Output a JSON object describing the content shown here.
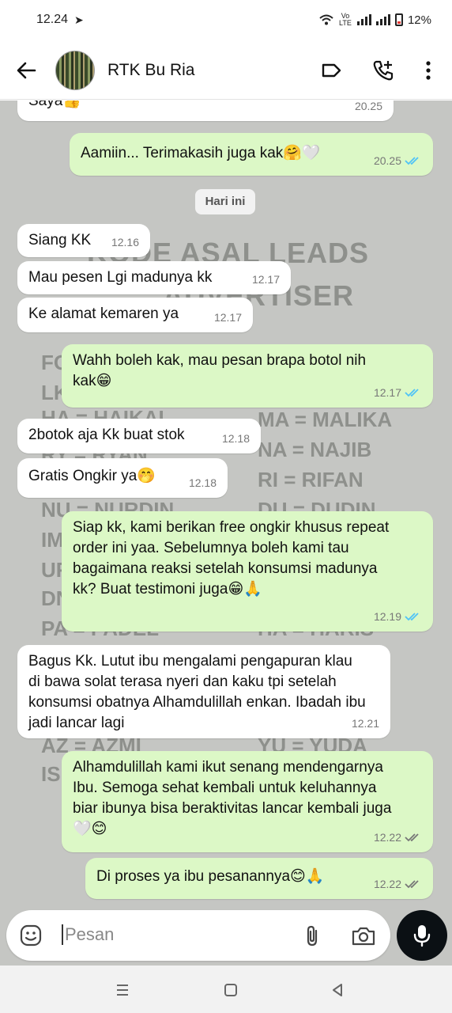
{
  "status": {
    "time": "12.24",
    "volte": "Vo LTE",
    "battery": "12%"
  },
  "header": {
    "contact_name": "RTK Bu Ria"
  },
  "date_separator": "Hari ini",
  "messages": [
    {
      "dir": "in",
      "text": "Saya👍",
      "time": "20.25"
    },
    {
      "dir": "out",
      "text": "Aamiin... Terimakasih juga kak🤗🤍",
      "time": "20.25",
      "status": "read"
    },
    {
      "dir": "in",
      "text": "Siang KK",
      "time": "12.16"
    },
    {
      "dir": "in",
      "text": "Mau pesen Lgi madunya kk",
      "time": "12.17"
    },
    {
      "dir": "in",
      "text": "Ke alamat kemaren ya",
      "time": "12.17"
    },
    {
      "dir": "out",
      "text": "Wahh boleh kak, mau pesan brapa botol nih kak😁",
      "time": "12.17",
      "status": "read"
    },
    {
      "dir": "in",
      "text": "2botok aja Kk buat stok",
      "time": "12.18"
    },
    {
      "dir": "in",
      "text": "Gratis Ongkir ya🤭",
      "time": "12.18"
    },
    {
      "dir": "out",
      "text": "Siap kk, kami berikan free ongkir khusus repeat order ini yaa. Sebelumnya boleh kami tau bagaimana reaksi setelah konsumsi madunya kk? Buat testimoni juga😁🙏",
      "time": "12.19",
      "status": "read"
    },
    {
      "dir": "in",
      "text": "Bagus Kk. Lutut ibu mengalami pengapuran klau di bawa solat terasa nyeri dan kaku tpi setelah konsumsi obatnya Alhamdulillah enkan. Ibadah ibu jadi lancar lagi",
      "time": "12.21"
    },
    {
      "dir": "out",
      "text": "Alhamdulillah kami ikut senang mendengarnya Ibu. Semoga sehat kembali untuk keluhannya biar ibunya bisa beraktivitas lancar kembali juga🤍😊",
      "time": "12.22",
      "status": "delivered"
    },
    {
      "dir": "out",
      "text": "Di proses ya ibu pesanannya😊🙏",
      "time": "12.22",
      "status": "delivered"
    }
  ],
  "background_text": {
    "title1": "KODE ASAL LEADS",
    "title2": "ADVERTISER",
    "left_codes": [
      "FO",
      "LK",
      "HA = HAIKAL",
      "RY = RYAN",
      "NU = NURDIN",
      "IM",
      "UF",
      "DN",
      "PA = PADEL",
      "AZ = AZMI",
      "IS"
    ],
    "right_codes": [
      "MA = MALIKA",
      "NA = NAJIB",
      "RI = RIFAN",
      "DU = DUDIN",
      "HA = HARIS",
      "YU = YUDA"
    ]
  },
  "input": {
    "placeholder": "Pesan"
  },
  "colors": {
    "incoming": "#ffffff",
    "outgoing": "#dcf8c6",
    "read_tick": "#4fc3f7",
    "delivered_tick": "#777777",
    "chat_bg": "#c5c6c3"
  }
}
